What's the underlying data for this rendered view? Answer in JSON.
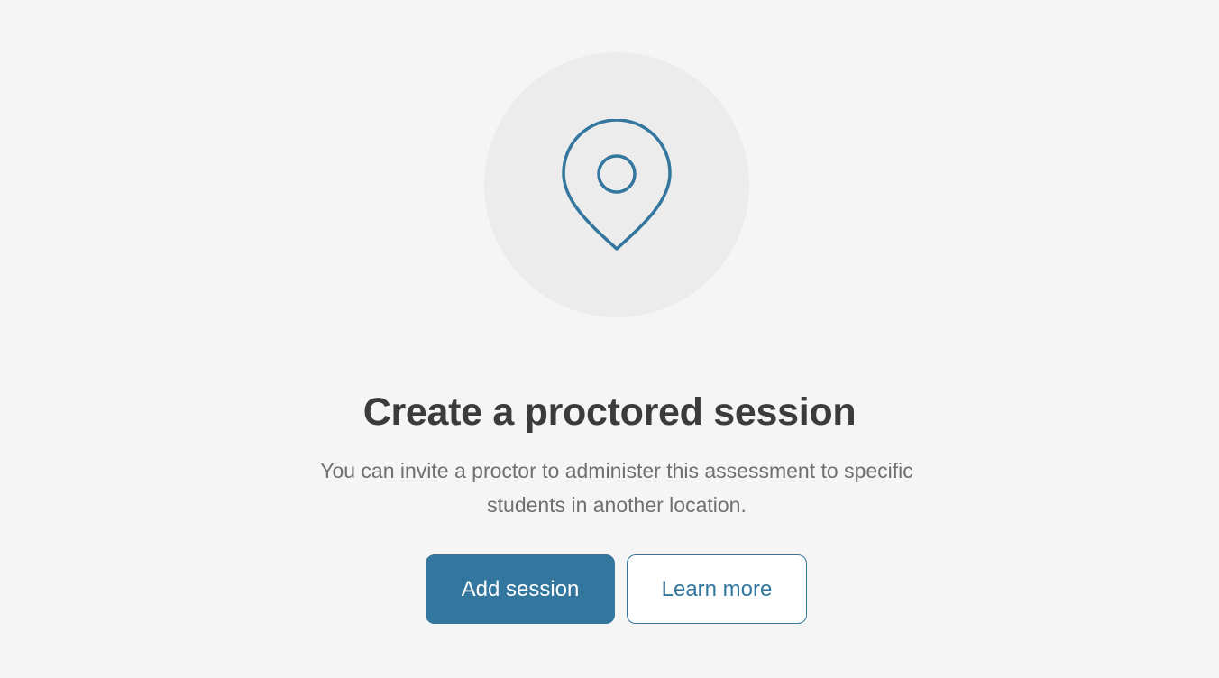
{
  "empty_state": {
    "icon": "map-pin-icon",
    "title": "Create a proctored session",
    "description": "You can invite a proctor to administer this assessment to specific students in another location.",
    "primary_button_label": "Add session",
    "secondary_button_label": "Learn more"
  },
  "colors": {
    "background": "#f5f5f5",
    "icon_circle": "#ececec",
    "accent": "#33769e",
    "title_text": "#3a3b3d",
    "body_text": "#6e6f71"
  }
}
